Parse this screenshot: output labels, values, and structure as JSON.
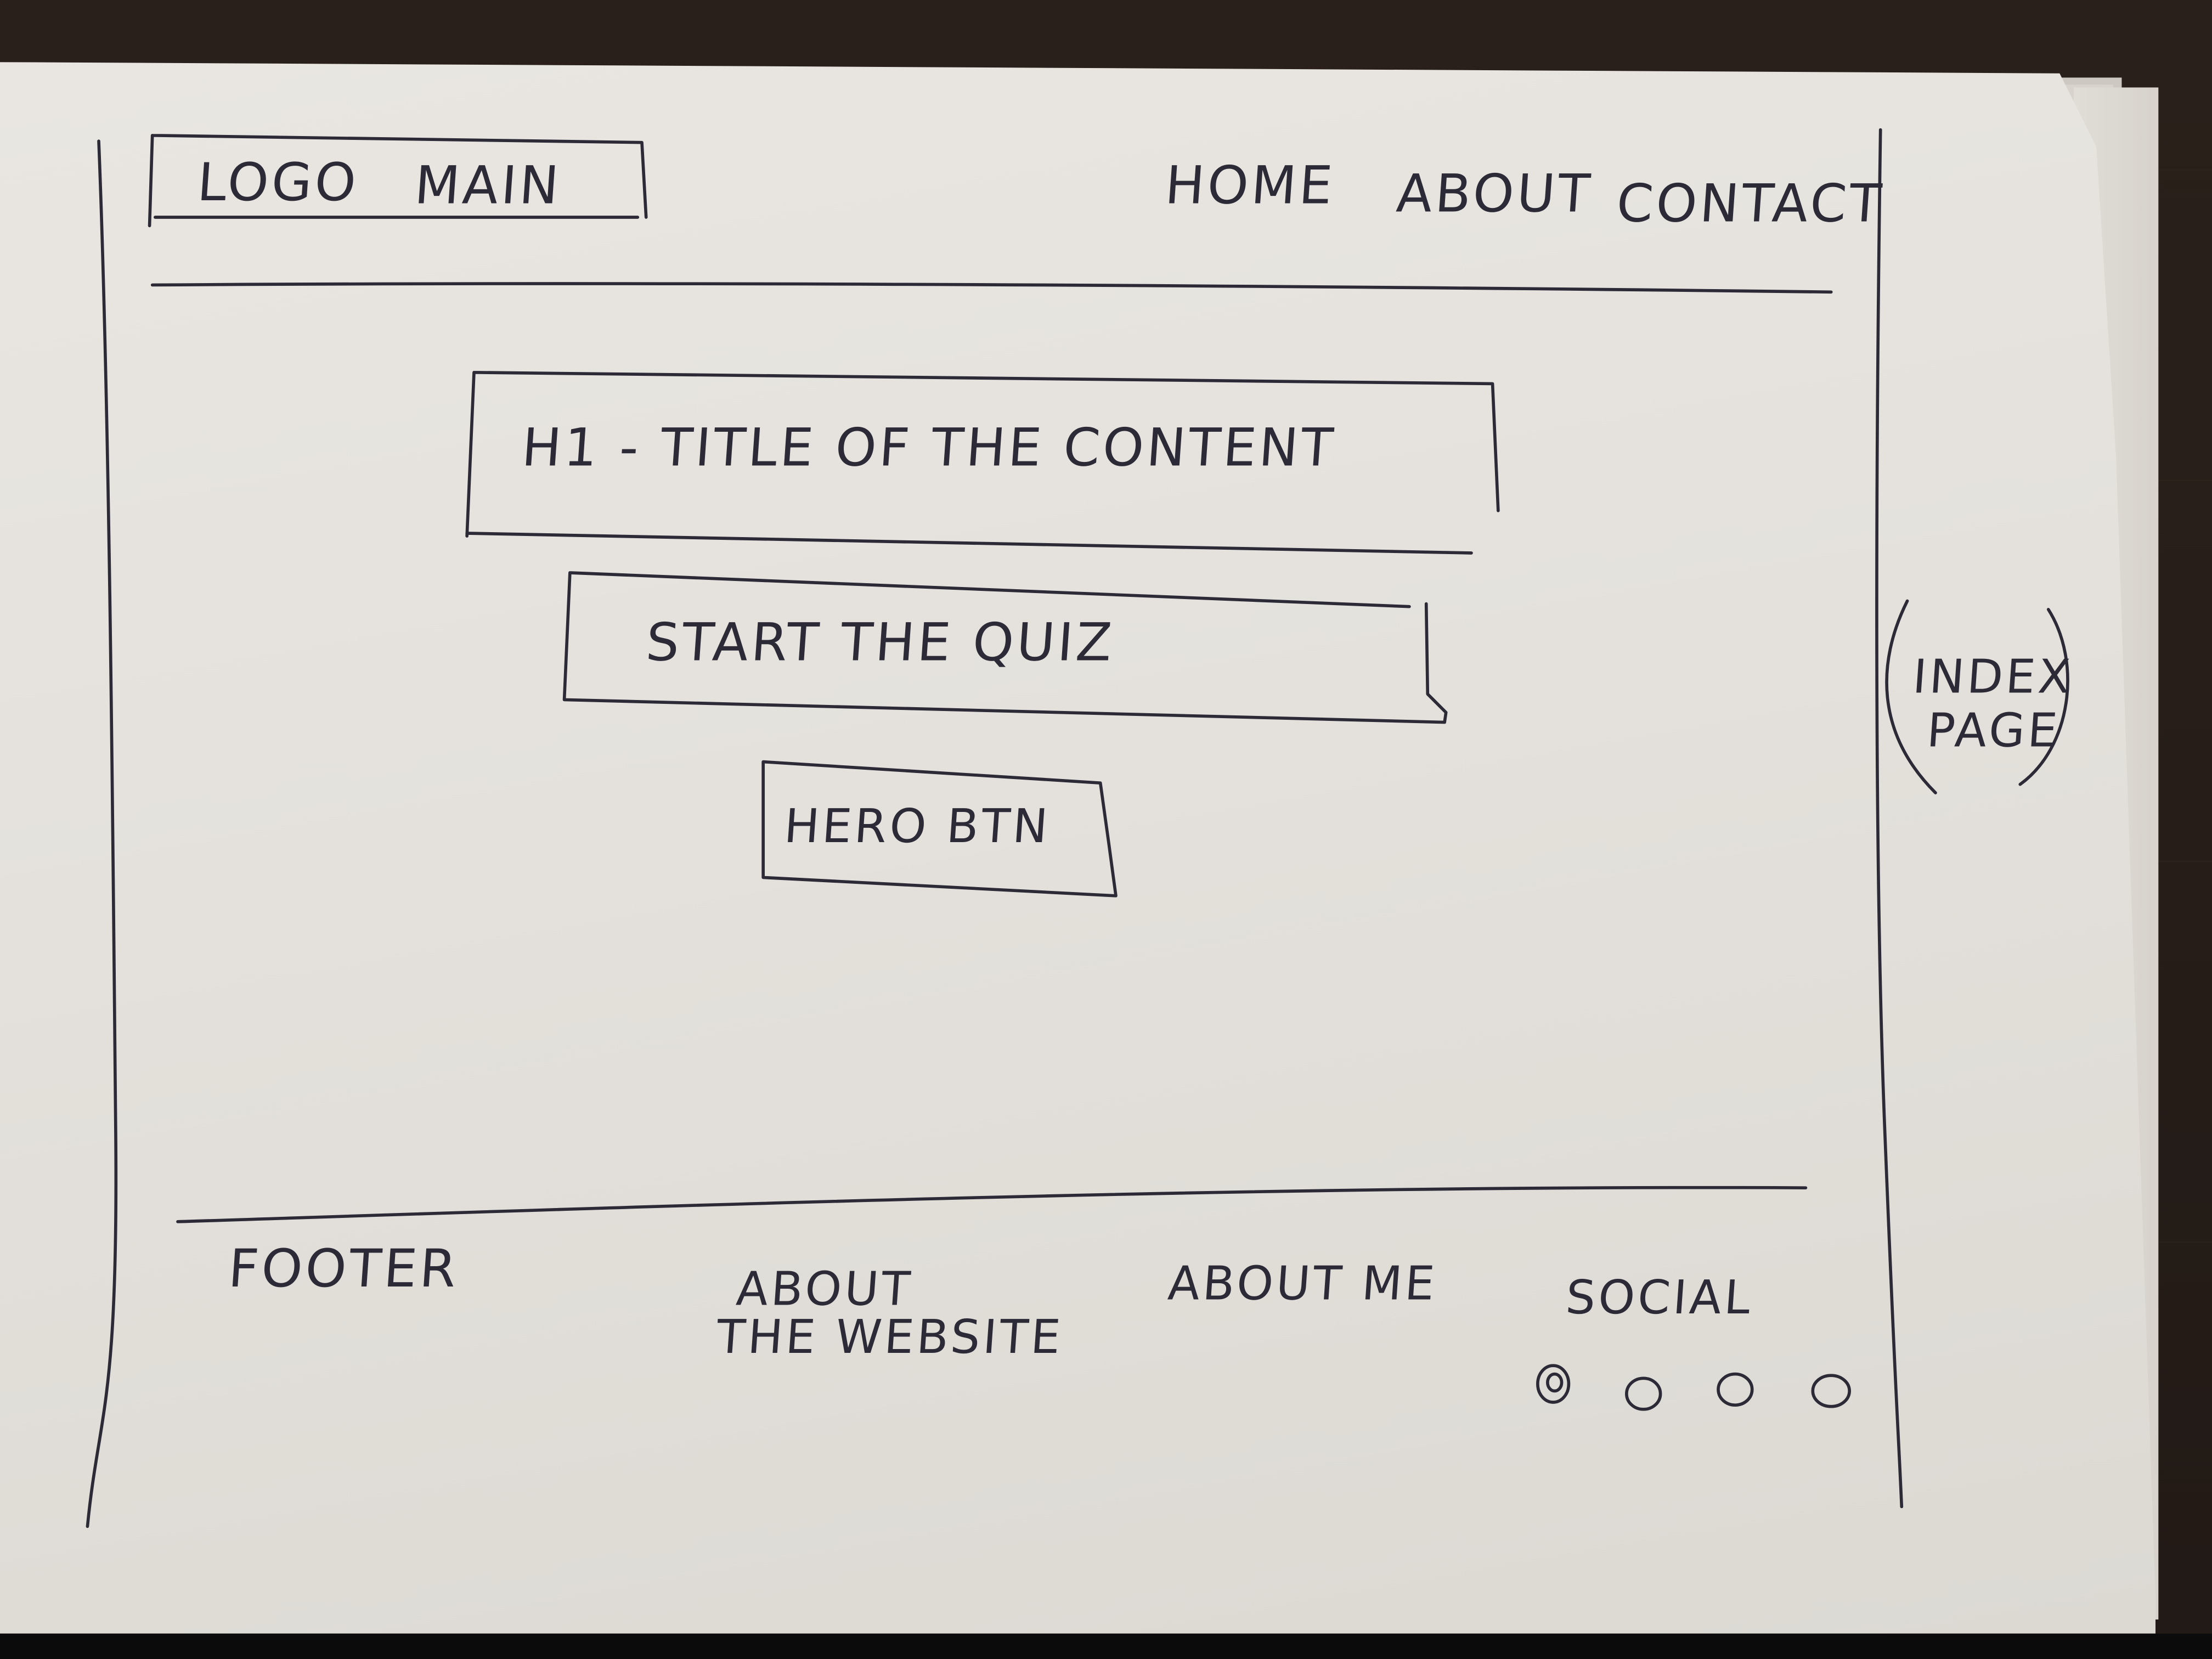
{
  "header": {
    "logo": "LOGO",
    "main": "MAIN",
    "nav": [
      "HOME",
      "ABOUT",
      "CONTACT"
    ]
  },
  "hero": {
    "title": "H1 - TITLE OF THE CONTENT",
    "subtitle": "START THE QUIZ",
    "button": "HERO BTN"
  },
  "annotation": {
    "line1": "INDEX",
    "line2": "PAGE"
  },
  "footer": {
    "label": "FOOTER",
    "about_website_line1": "ABOUT",
    "about_website_line2": "THE WEBSITE",
    "about_me": "ABOUT ME",
    "social": "SOCIAL",
    "social_icons": [
      "circle-icon",
      "circle-icon",
      "circle-icon",
      "circle-icon"
    ]
  },
  "colors": {
    "ink": "#2c2a36",
    "paper": "#e7e4df",
    "table": "#241b17"
  }
}
